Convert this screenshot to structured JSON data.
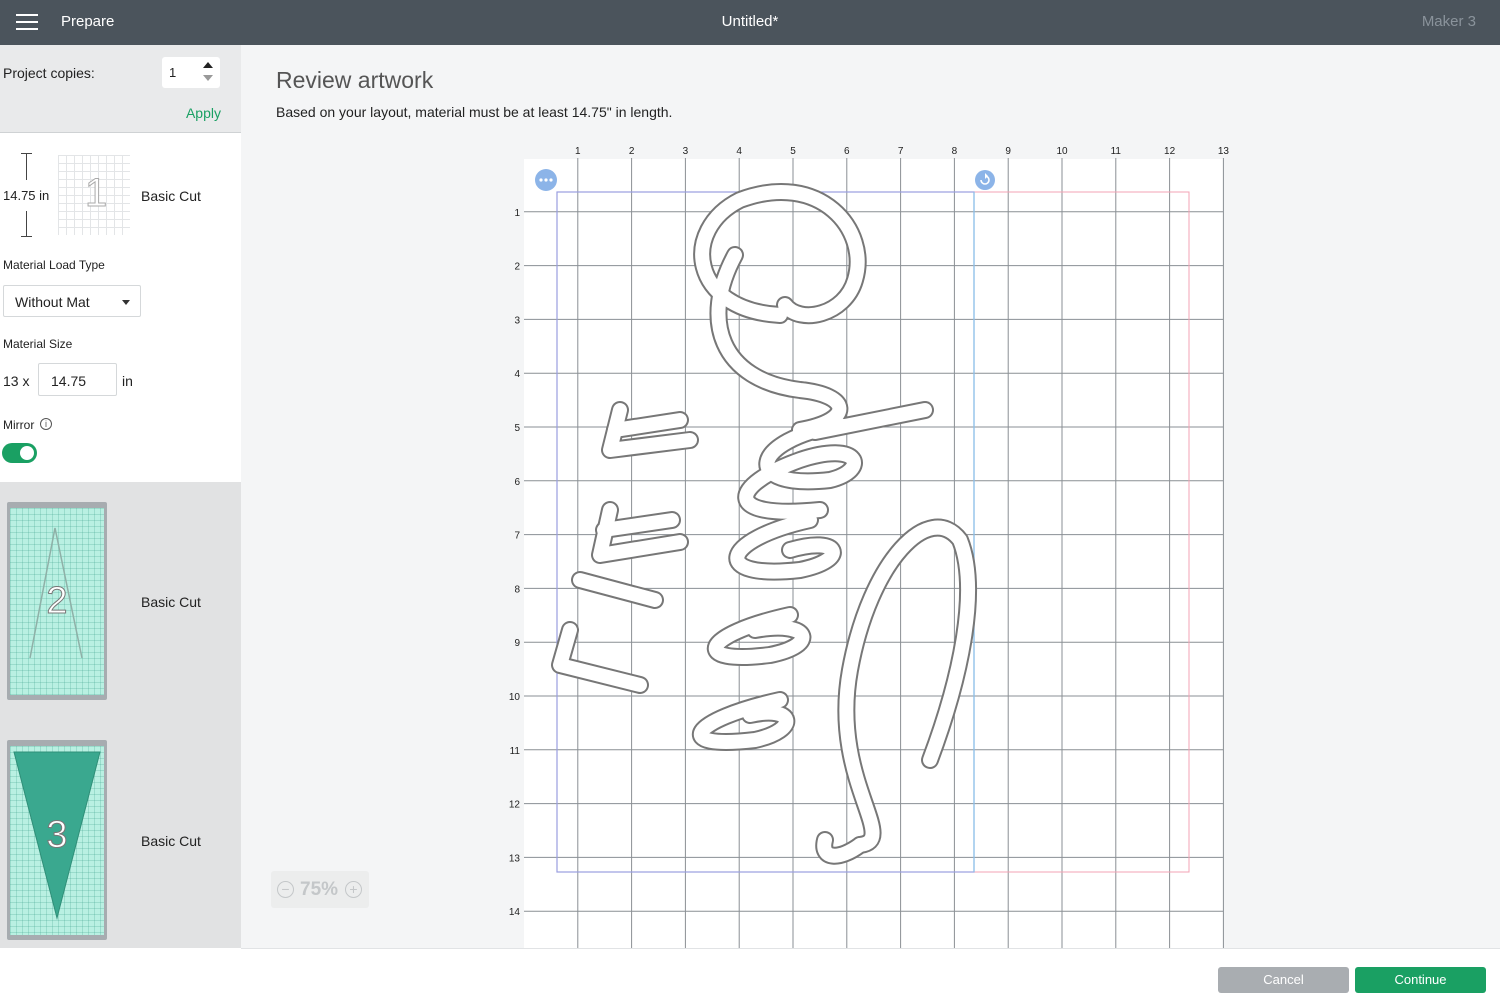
{
  "topbar": {
    "section": "Prepare",
    "doc_title": "Untitled*",
    "machine": "Maker 3"
  },
  "sidebar": {
    "project_copies_label": "Project copies:",
    "project_copies_value": "1",
    "apply_label": "Apply",
    "mat1": {
      "length": "14.75 in",
      "number": "1",
      "name": "Basic Cut"
    },
    "material_load_type_label": "Material Load Type",
    "material_load_type_value": "Without Mat",
    "material_size_label": "Material Size",
    "material_size_width": "13 x",
    "material_size_length": "14.75",
    "material_size_unit": "in",
    "mirror_label": "Mirror",
    "mirror_on": true,
    "mat2": {
      "number": "2",
      "name": "Basic Cut"
    },
    "mat3": {
      "number": "3",
      "name": "Basic Cut"
    }
  },
  "main": {
    "title": "Review artwork",
    "subtitle": "Based on your layout, material must be at least 14.75\" in length.",
    "ruler_top": [
      "1",
      "2",
      "3",
      "4",
      "5",
      "6",
      "7",
      "8",
      "9",
      "10",
      "11",
      "12",
      "13"
    ],
    "ruler_left": [
      "1",
      "2",
      "3",
      "4",
      "5",
      "6",
      "7",
      "8",
      "9",
      "10",
      "11",
      "12",
      "13",
      "14"
    ],
    "zoom_value": "75%",
    "zoom_minus": "−",
    "zoom_plus": "+"
  },
  "footer": {
    "cancel_label": "Cancel",
    "continue_label": "Continue"
  },
  "colors": {
    "topbar": "#4b545c",
    "accent_green": "#1aa063",
    "mat_light": "#b9f0e2",
    "mat_teal": "#4cbfa6"
  }
}
